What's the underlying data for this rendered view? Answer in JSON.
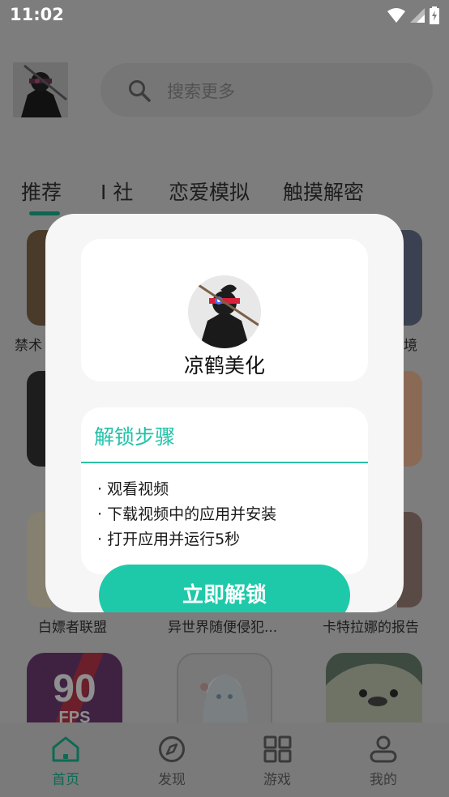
{
  "status_bar": {
    "time": "11:02"
  },
  "header": {
    "search_placeholder": "搜索更多"
  },
  "tabs": [
    {
      "label": "推荐",
      "active": true
    },
    {
      "label": "I 社",
      "active": false
    },
    {
      "label": "恋爱模拟",
      "active": false
    },
    {
      "label": "触摸解密",
      "active": false
    }
  ],
  "grid": {
    "row1_labels": [
      "禁术",
      "",
      "境"
    ],
    "row3_labels": [
      "白嫖者联盟",
      "异世界随便侵犯...",
      "卡特拉娜的报告"
    ]
  },
  "bottom_nav": [
    {
      "label": "首页",
      "icon": "home-icon",
      "active": true
    },
    {
      "label": "发现",
      "icon": "compass-icon",
      "active": false
    },
    {
      "label": "游戏",
      "icon": "grid-icon",
      "active": false
    },
    {
      "label": "我的",
      "icon": "person-icon",
      "active": false
    }
  ],
  "dialog": {
    "profile_name": "凉鹤美化",
    "steps_title": "解锁步骤",
    "steps": [
      "· 观看视频",
      "· 下载视频中的应用并安装",
      "· 打开应用并运行5秒"
    ],
    "unlock_button": "立即解锁"
  },
  "colors": {
    "accent": "#1ec9a9",
    "accent_text": "#22c2a7",
    "nav_active": "#0d6a54",
    "dim_background": "#7d7d7d"
  }
}
